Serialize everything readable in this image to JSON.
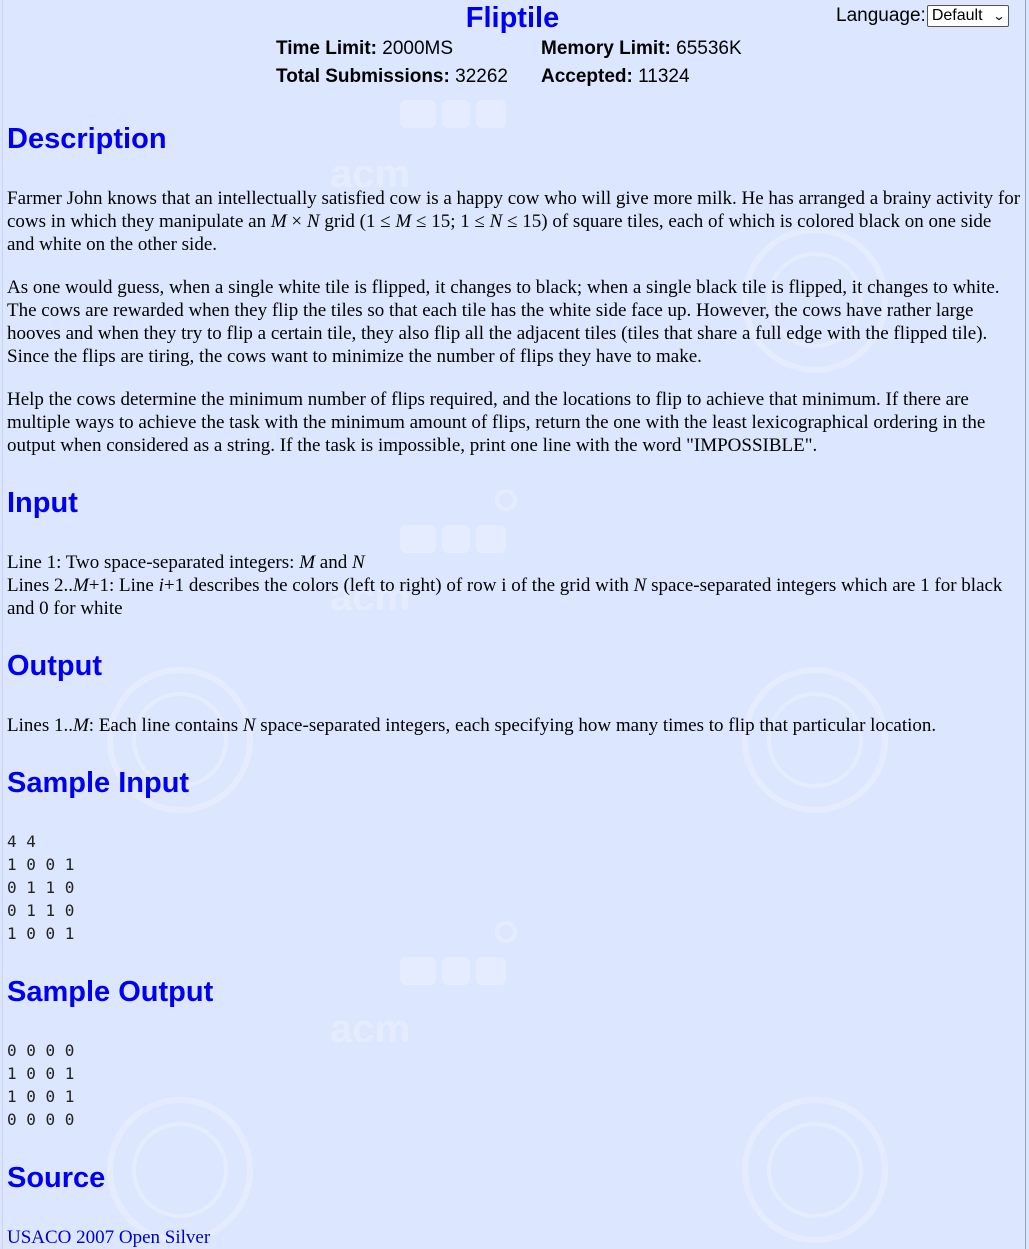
{
  "problem": {
    "title": "Fliptile",
    "language_label": "Language:",
    "language_selected": "Default",
    "time_limit_label": "Time Limit:",
    "time_limit_value": "2000MS",
    "memory_limit_label": "Memory Limit:",
    "memory_limit_value": "65536K",
    "total_submissions_label": "Total Submissions:",
    "total_submissions_value": "32262",
    "accepted_label": "Accepted:",
    "accepted_value": "11324"
  },
  "sections": {
    "description_heading": "Description",
    "input_heading": "Input",
    "output_heading": "Output",
    "sample_input_heading": "Sample Input",
    "sample_output_heading": "Sample Output",
    "source_heading": "Source"
  },
  "description": {
    "p1_a": "Farmer John knows that an intellectually satisfied cow is a happy cow who will give more milk. He has arranged a brainy activity for cows in which they manipulate an ",
    "p1_m": "M",
    "p1_times": " × ",
    "p1_n": "N",
    "p1_b": " grid (1 ≤ ",
    "p1_m2": "M",
    "p1_c": " ≤ 15; 1 ≤ ",
    "p1_n2": "N",
    "p1_d": " ≤ 15) of square tiles, each of which is colored black on one side and white on the other side.",
    "p2": "As one would guess, when a single white tile is flipped, it changes to black; when a single black tile is flipped, it changes to white. The cows are rewarded when they flip the tiles so that each tile has the white side face up. However, the cows have rather large hooves and when they try to flip a certain tile, they also flip all the adjacent tiles (tiles that share a full edge with the flipped tile). Since the flips are tiring, the cows want to minimize the number of flips they have to make.",
    "p3": "Help the cows determine the minimum number of flips required, and the locations to flip to achieve that minimum. If there are multiple ways to achieve the task with the minimum amount of flips, return the one with the least lexicographical ordering in the output when considered as a string. If the task is impossible, print one line with the word \"IMPOSSIBLE\"."
  },
  "input": {
    "l1_a": "Line 1: Two space-separated integers: ",
    "l1_m": "M",
    "l1_b": " and ",
    "l1_n": "N",
    "l2_a": "Lines 2..",
    "l2_m": "M",
    "l2_b": "+1: Line ",
    "l2_i": "i",
    "l2_c": "+1 describes the colors (left to right) of row i of the grid with ",
    "l2_n": "N",
    "l2_d": " space-separated integers which are 1 for black and 0 for white"
  },
  "output": {
    "a": "Lines 1..",
    "m": "M",
    "b": ": Each line contains ",
    "n": "N",
    "c": " space-separated integers, each specifying how many times to flip that particular location."
  },
  "sample_input": "4 4\n1 0 0 1\n0 1 1 0\n0 1 1 0\n1 0 0 1",
  "sample_output": "0 0 0 0\n1 0 0 1\n1 0 0 1\n0 0 0 0",
  "source": {
    "link_text": "USACO 2007 Open Silver"
  },
  "colors": {
    "background": "#dce6ff",
    "heading": "#0000ee",
    "link": "#0000cc"
  }
}
